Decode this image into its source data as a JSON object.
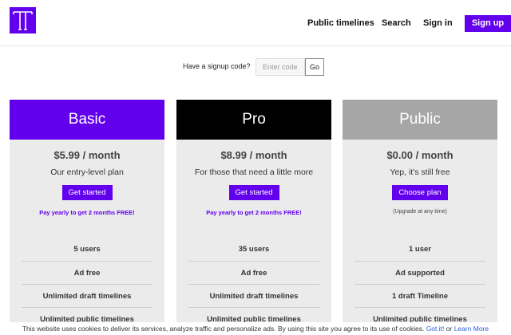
{
  "brand": {
    "accent": "#6200ee",
    "logo_icon": "tt-logo-icon"
  },
  "nav": {
    "public_timelines": "Public timelines",
    "search": "Search",
    "sign_in": "Sign in",
    "sign_up": "Sign up"
  },
  "signup_code": {
    "label": "Have a signup code?",
    "placeholder": "Enter code",
    "button": "Go"
  },
  "plans": [
    {
      "name": "Basic",
      "header_color": "#6200ee",
      "price": "$5.99 / month",
      "tagline": "Our entry-level plan",
      "cta": "Get started",
      "note": "Pay yearly to get 2 months FREE!",
      "features": [
        "5 users",
        "Ad free",
        "Unlimited draft timelines",
        "Unlimited public timelines"
      ]
    },
    {
      "name": "Pro",
      "header_color": "#000000",
      "price": "$8.99 / month",
      "tagline": "For those that need a little more",
      "cta": "Get started",
      "note": "Pay yearly to get 2 months FREE!",
      "features": [
        "35 users",
        "Ad free",
        "Unlimited draft timelines",
        "Unlimited public timelines"
      ]
    },
    {
      "name": "Public",
      "header_color": "#a6a6a6",
      "price": "$0.00 / month",
      "tagline": "Yep, it's still free",
      "cta": "Choose plan",
      "note": "(Upgrade at any time)",
      "features": [
        "1 user",
        "Ad supported",
        "1 draft Timeline",
        "Unlimited public timelines"
      ]
    }
  ],
  "cookie": {
    "text": "This website uses cookies to deliver its services, analyze traffic and personalize ads. By using this site you agree to its use of cookies.",
    "got_it": "Got it!",
    "or": "or",
    "learn_more": "Learn More"
  }
}
